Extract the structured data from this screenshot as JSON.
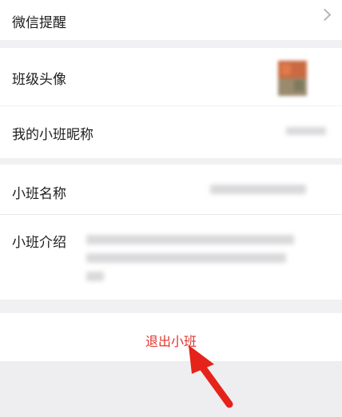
{
  "settings": {
    "wechat_reminder": "微信提醒",
    "class_avatar": "班级头像",
    "my_nickname": "我的小班昵称",
    "class_name": "小班名称",
    "class_intro": "小班介绍"
  },
  "actions": {
    "exit_class": "退出小班"
  },
  "colors": {
    "accent_red": "#e0352c",
    "background": "#f1f1f3",
    "row_bg": "#ffffff"
  }
}
